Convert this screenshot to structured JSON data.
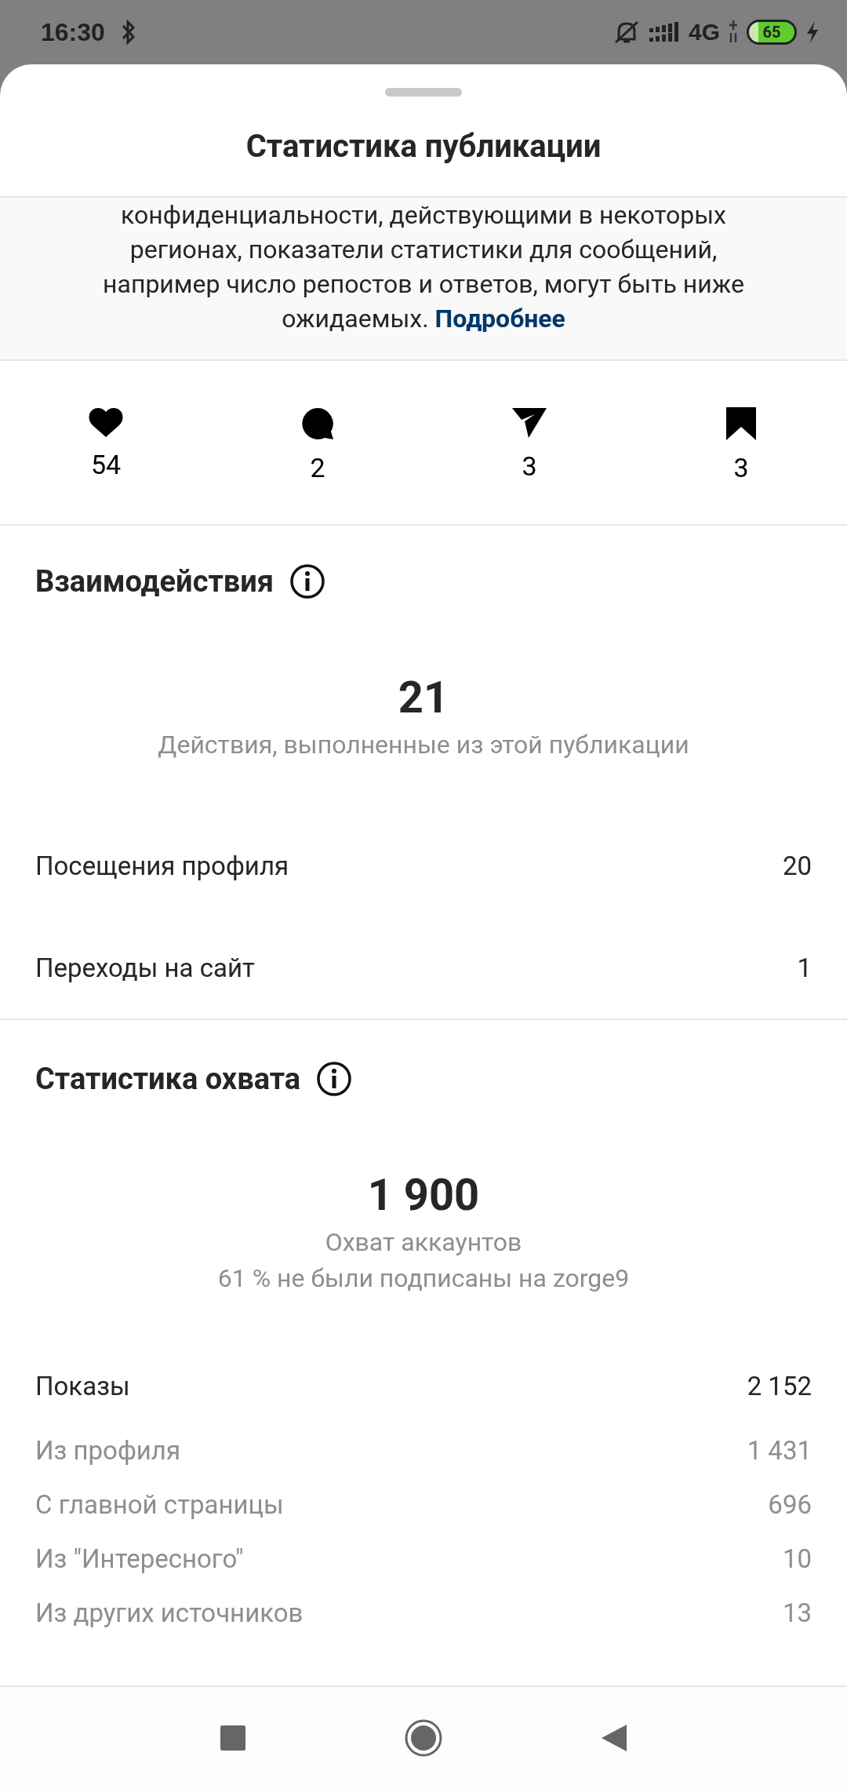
{
  "status_bar": {
    "time": "16:30",
    "network": "4G",
    "battery": "65"
  },
  "title": "Статистика публикации",
  "notice": {
    "text": "конфиденциальности, действующими в некоторых регионах, показатели статистики для сообщений, например число репостов и ответов, могут быть ниже ожидаемых.",
    "link": "Подробнее"
  },
  "counters": [
    {
      "kind": "likes",
      "value": "54"
    },
    {
      "kind": "comments",
      "value": "2"
    },
    {
      "kind": "shares",
      "value": "3"
    },
    {
      "kind": "saves",
      "value": "3"
    }
  ],
  "sections": [
    {
      "title": "Взаимодействия",
      "total": "21",
      "captions": [
        "Действия, выполненные из этой публикации"
      ],
      "rows": [
        {
          "kind": "main",
          "label": "Посещения профиля",
          "value": "20"
        },
        {
          "kind": "main",
          "label": "Переходы на сайт",
          "value": "1"
        }
      ]
    },
    {
      "title": "Статистика охвата",
      "total": "1 900",
      "captions": [
        "Охват аккаунтов",
        "61 % не были подписаны на zorge9"
      ],
      "rows": [
        {
          "kind": "main",
          "label": "Показы",
          "value": "2 152"
        },
        {
          "kind": "sub",
          "label": "Из профиля",
          "value": "1 431"
        },
        {
          "kind": "sub",
          "label": "С главной страницы",
          "value": "696"
        },
        {
          "kind": "sub",
          "label": "Из \"Интересного\"",
          "value": "10"
        },
        {
          "kind": "sub",
          "label": "Из других источников",
          "value": "13"
        }
      ]
    }
  ]
}
